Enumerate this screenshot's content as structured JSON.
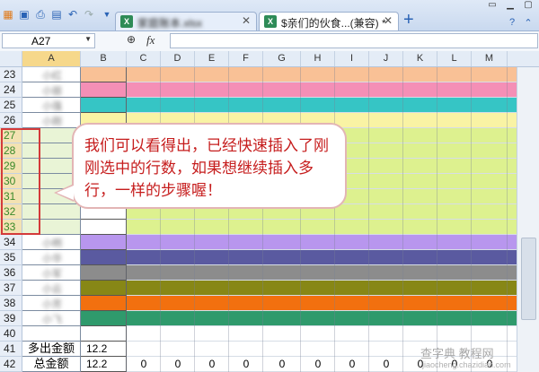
{
  "tabs": [
    {
      "label": "家庭账本.xlsx",
      "blurred": true,
      "active": false
    },
    {
      "label": "$亲们的伙食...(兼容) *",
      "active": true
    }
  ],
  "new_tab_icon": "plus-icon",
  "namebox": {
    "value": "A27"
  },
  "formula": {
    "fx_label": "fx",
    "value": ""
  },
  "columns": [
    "A",
    "B",
    "C",
    "D",
    "E",
    "F",
    "G",
    "H",
    "I",
    "J",
    "K",
    "L",
    "M"
  ],
  "selected_column": "A",
  "rows": [
    {
      "n": "23",
      "color": "#f9c196",
      "blur": "小红"
    },
    {
      "n": "24",
      "color": "#f48fb6",
      "blur": "小丽"
    },
    {
      "n": "25",
      "color": "#36c5c5",
      "blur": "小强"
    },
    {
      "n": "26",
      "color": "#f9f3a4",
      "blur": "小刚"
    },
    {
      "n": "27",
      "color": "#ddf18f",
      "blur": "",
      "selected": true
    },
    {
      "n": "28",
      "color": "#ddf18f",
      "blur": "",
      "selected": true
    },
    {
      "n": "29",
      "color": "#ddf18f",
      "blur": "",
      "selected": true
    },
    {
      "n": "30",
      "color": "#ddf18f",
      "blur": "",
      "selected": true
    },
    {
      "n": "31",
      "color": "#ddf18f",
      "blur": "",
      "selected": true
    },
    {
      "n": "32",
      "color": "#ddf18f",
      "blur": "",
      "selected": true
    },
    {
      "n": "33",
      "color": "#ddf18f",
      "blur": "",
      "selected": true
    },
    {
      "n": "34",
      "color": "#b896ee",
      "blur": "小明"
    },
    {
      "n": "35",
      "color": "#5a5aa0",
      "blur": "小华"
    },
    {
      "n": "36",
      "color": "#8c8c8c",
      "blur": "小军"
    },
    {
      "n": "37",
      "color": "#878716",
      "blur": "小云"
    },
    {
      "n": "38",
      "color": "#f2700f",
      "blur": "小芳"
    },
    {
      "n": "39",
      "color": "#2f9a6c",
      "blur": "小飞"
    },
    {
      "n": "40",
      "color": "",
      "blur": ""
    },
    {
      "n": "41",
      "color": "",
      "label": "多出金额",
      "b": "12.2"
    },
    {
      "n": "42",
      "color": "",
      "label": "总金额",
      "b": "12.2",
      "zeros": true
    }
  ],
  "zero_value": "0",
  "callout_text": "我们可以看得出，已经快速插入了刚刚选中的行数，如果想继续插入多行，一样的步骤喔！",
  "watermark": "查字典 教程网",
  "watermark_url": "jiaocheng.chazidian.com"
}
